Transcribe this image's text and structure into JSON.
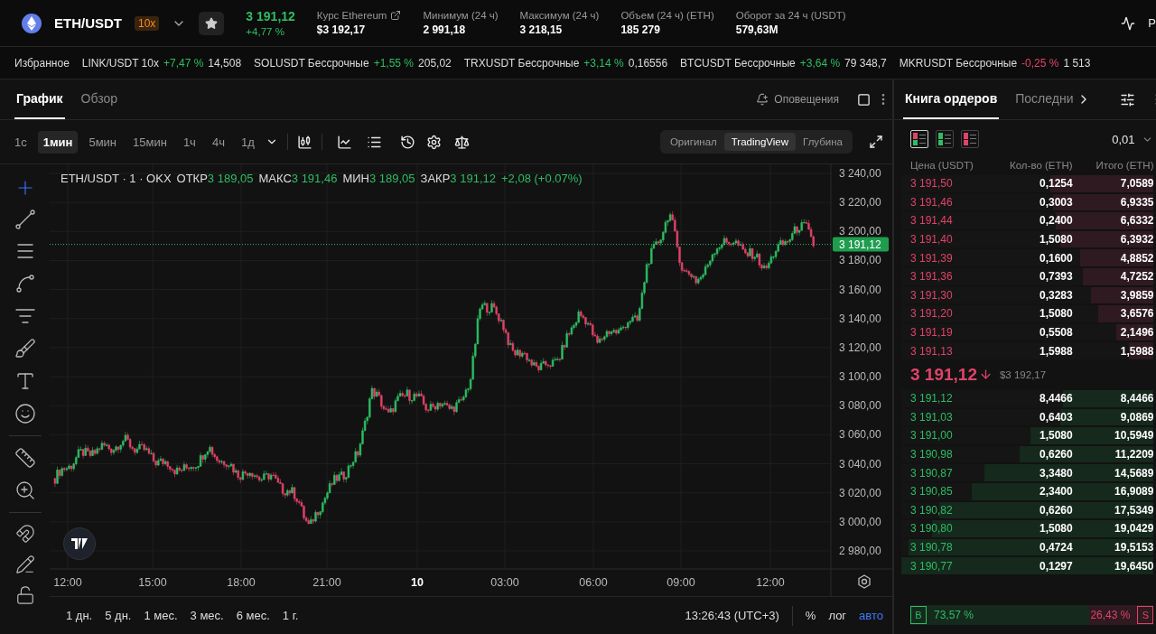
{
  "header": {
    "pair": "ETH/USDT",
    "leverage": "10x",
    "price": "3 191,12",
    "change": "+4,77 %",
    "extra": "P",
    "stats": [
      {
        "label": "Курс Ethereum",
        "value": "$3 192,17",
        "link": true
      },
      {
        "label": "Минимум (24 ч)",
        "value": "2 991,18",
        "link": false
      },
      {
        "label": "Максимум (24 ч)",
        "value": "3 218,15",
        "link": false
      },
      {
        "label": "Объем (24 ч) (ETH)",
        "value": "185 279",
        "link": false
      },
      {
        "label": "Оборот за 24 ч (USDT)",
        "value": "579,63M",
        "link": false
      }
    ]
  },
  "ticker": {
    "title": "Избранное",
    "items": [
      {
        "name": "LINK/USDT 10x",
        "change": "+7,47 %",
        "price": "14,508",
        "color": "#2ebd63"
      },
      {
        "name": "SOLUSDT Бессрочные",
        "change": "+1,55 %",
        "price": "205,02",
        "color": "#2ebd63"
      },
      {
        "name": "TRXUSDT Бессрочные",
        "change": "+3,14 %",
        "price": "0,16556",
        "color": "#2ebd63"
      },
      {
        "name": "BTCUSDT Бессрочные",
        "change": "+3,64 %",
        "price": "79 348,7",
        "color": "#2ebd63"
      },
      {
        "name": "MKRUSDT Бессрочные",
        "change": "-0,25 %",
        "price": "1 513",
        "color": "#e0436a"
      }
    ]
  },
  "chart_panel": {
    "tabs": [
      {
        "label": "График",
        "selected": true
      },
      {
        "label": "Обзор",
        "selected": false
      }
    ],
    "alerts": "Оповещения",
    "intervals": [
      {
        "label": "1с",
        "selected": false
      },
      {
        "label": "1мин",
        "selected": true
      },
      {
        "label": "5мин",
        "selected": false
      },
      {
        "label": "15мин",
        "selected": false
      },
      {
        "label": "1ч",
        "selected": false
      },
      {
        "label": "4ч",
        "selected": false
      },
      {
        "label": "1д",
        "selected": false
      }
    ],
    "views": [
      {
        "label": "Оригинал",
        "selected": false
      },
      {
        "label": "TradingView",
        "selected": true
      },
      {
        "label": "Глубина",
        "selected": false
      }
    ],
    "legend": {
      "title": "ETH/USDT · 1 · OKX",
      "fields": [
        {
          "label": "ОТКР",
          "value": "3 189,05"
        },
        {
          "label": "МАКС",
          "value": "3 191,46"
        },
        {
          "label": "МИН",
          "value": "3 189,05"
        },
        {
          "label": "ЗАКР",
          "value": "3 191,12"
        }
      ],
      "change": "+2,08 (+0.07%)"
    },
    "price_ticks": [
      "3 240,00",
      "3 220,00",
      "3 200,00",
      "3 180,00",
      "3 160,00",
      "3 140,00",
      "3 120,00",
      "3 100,00",
      "3 080,00",
      "3 060,00",
      "3 040,00",
      "3 020,00",
      "3 000,00",
      "2 980,00"
    ],
    "current_price": "3 191,12",
    "time_ticks": [
      {
        "label": "12:00",
        "kind": "time"
      },
      {
        "label": "15:00",
        "kind": "time"
      },
      {
        "label": "18:00",
        "kind": "time"
      },
      {
        "label": "21:00",
        "kind": "time"
      },
      {
        "label": "10",
        "kind": "day"
      },
      {
        "label": "03:00",
        "kind": "time"
      },
      {
        "label": "06:00",
        "kind": "time"
      },
      {
        "label": "09:00",
        "kind": "time"
      },
      {
        "label": "12:00",
        "kind": "time"
      }
    ],
    "ranges": [
      "1 дн.",
      "5 дн.",
      "1 мес.",
      "3 мес.",
      "6 мес.",
      "1 г."
    ],
    "clock": "13:26:43 (UTC+3)",
    "scales": [
      {
        "label": "%",
        "selected": false
      },
      {
        "label": "лог",
        "selected": false
      },
      {
        "label": "авто",
        "selected": true
      }
    ]
  },
  "order_book": {
    "tabs": [
      {
        "label": "Книга ордеров",
        "selected": true
      },
      {
        "label": "Последни",
        "selected": false
      }
    ],
    "layouts": [
      {
        "kind": "both",
        "selected": true
      },
      {
        "kind": "bids",
        "selected": false
      },
      {
        "kind": "asks",
        "selected": false
      }
    ],
    "step": "0,01",
    "columns": [
      "Цена (USDT)",
      "Кол-во (ETH)",
      "Итого (ETH)"
    ],
    "asks": [
      {
        "price": "3 191,50",
        "amount": "0,1254",
        "total": "7,0589",
        "level": 0.41
      },
      {
        "price": "3 191,46",
        "amount": "0,3003",
        "total": "6,9335",
        "level": 0.4
      },
      {
        "price": "3 191,44",
        "amount": "0,2400",
        "total": "6,6332",
        "level": 0.39
      },
      {
        "price": "3 191,40",
        "amount": "1,5080",
        "total": "6,3932",
        "level": 0.37
      },
      {
        "price": "3 191,39",
        "amount": "0,1600",
        "total": "4,8852",
        "level": 0.29
      },
      {
        "price": "3 191,36",
        "amount": "0,7393",
        "total": "4,7252",
        "level": 0.28
      },
      {
        "price": "3 191,30",
        "amount": "0,3283",
        "total": "3,9859",
        "level": 0.25
      },
      {
        "price": "3 191,20",
        "amount": "1,5080",
        "total": "3,6576",
        "level": 0.22
      },
      {
        "price": "3 191,19",
        "amount": "0,5508",
        "total": "2,1496",
        "level": 0.15
      },
      {
        "price": "3 191,13",
        "amount": "1,5988",
        "total": "1,5988",
        "level": 0.1
      }
    ],
    "last_price": "3 191,12",
    "mark_price": "$3 192,17",
    "bids": [
      {
        "price": "3 191,12",
        "amount": "8,4466",
        "total": "8,4466",
        "level": 0.36
      },
      {
        "price": "3 191,03",
        "amount": "0,6403",
        "total": "9,0869",
        "level": 0.37
      },
      {
        "price": "3 191,00",
        "amount": "1,5080",
        "total": "10,5949",
        "level": 0.49
      },
      {
        "price": "3 190,98",
        "amount": "0,6260",
        "total": "11,2209",
        "level": 0.53
      },
      {
        "price": "3 190,87",
        "amount": "3,3480",
        "total": "14,5689",
        "level": 0.67
      },
      {
        "price": "3 190,85",
        "amount": "2,3400",
        "total": "16,9089",
        "level": 0.72
      },
      {
        "price": "3 190,82",
        "amount": "0,6260",
        "total": "17,5349",
        "level": 0.85
      },
      {
        "price": "3 190,80",
        "amount": "1,5080",
        "total": "19,0429",
        "level": 0.88
      },
      {
        "price": "3 190,78",
        "amount": "0,4724",
        "total": "19,5153",
        "level": 0.97
      },
      {
        "price": "3 190,77",
        "amount": "0,1297",
        "total": "19,6450",
        "level": 1.0
      }
    ],
    "balance": {
      "buy_key": "B",
      "buy": "73,57 %",
      "sell": "26,43 %",
      "sell_key": "S",
      "level": 0.7357
    }
  }
}
